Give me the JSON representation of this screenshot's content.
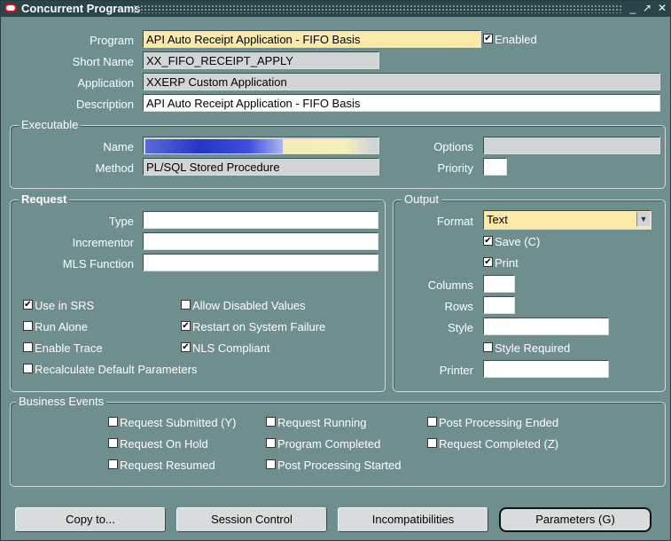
{
  "window": {
    "title": "Concurrent Programs"
  },
  "header": {
    "program_label": "Program",
    "program_value": "API Auto Receipt Application - FIFO Basis",
    "enabled_label": "Enabled",
    "enabled_checked": true,
    "short_name_label": "Short Name",
    "short_name_value": "XX_FIFO_RECEIPT_APPLY",
    "application_label": "Application",
    "application_value": "XXERP Custom Application",
    "description_label": "Description",
    "description_value": "API Auto Receipt Application - FIFO Basis"
  },
  "executable": {
    "title": "Executable",
    "name_label": "Name",
    "method_label": "Method",
    "method_value": "PL/SQL Stored Procedure",
    "options_label": "Options",
    "options_value": "",
    "priority_label": "Priority",
    "priority_value": ""
  },
  "request": {
    "title": "Request",
    "type_label": "Type",
    "incrementor_label": "Incrementor",
    "mls_label": "MLS Function",
    "checks": [
      {
        "label": "Use in SRS",
        "checked": true
      },
      {
        "label": "Allow Disabled Values",
        "checked": false
      },
      {
        "label": "Run Alone",
        "checked": false
      },
      {
        "label": "Restart on System Failure",
        "checked": true
      },
      {
        "label": "Enable Trace",
        "checked": false
      },
      {
        "label": "NLS Compliant",
        "checked": true
      },
      {
        "label": "Recalculate Default Parameters",
        "checked": false
      }
    ]
  },
  "output": {
    "title": "Output",
    "format_label": "Format",
    "format_value": "Text",
    "save_label": "Save (C)",
    "save_checked": true,
    "print_label": "Print",
    "print_checked": true,
    "columns_label": "Columns",
    "rows_label": "Rows",
    "style_label": "Style",
    "style_required_label": "Style Required",
    "style_required_checked": false,
    "printer_label": "Printer"
  },
  "business_events": {
    "title": "Business Events",
    "items": [
      {
        "label": "Request Submitted (Y)",
        "checked": false
      },
      {
        "label": "Request Running",
        "checked": false
      },
      {
        "label": "Post Processing Ended",
        "checked": false
      },
      {
        "label": "Request On Hold",
        "checked": false
      },
      {
        "label": "Program Completed",
        "checked": false
      },
      {
        "label": "Request Completed (Z)",
        "checked": false
      },
      {
        "label": "Request Resumed",
        "checked": false
      },
      {
        "label": "Post Processing Started",
        "checked": false
      }
    ]
  },
  "buttons": {
    "copy": "Copy to...",
    "session": "Session Control",
    "incompat": "Incompatibilities",
    "params": "Parameters (G)"
  },
  "colors": {
    "titlebar": "#2a4549",
    "canvas": "#6f8f8e",
    "required_field": "#fdeaa8"
  }
}
